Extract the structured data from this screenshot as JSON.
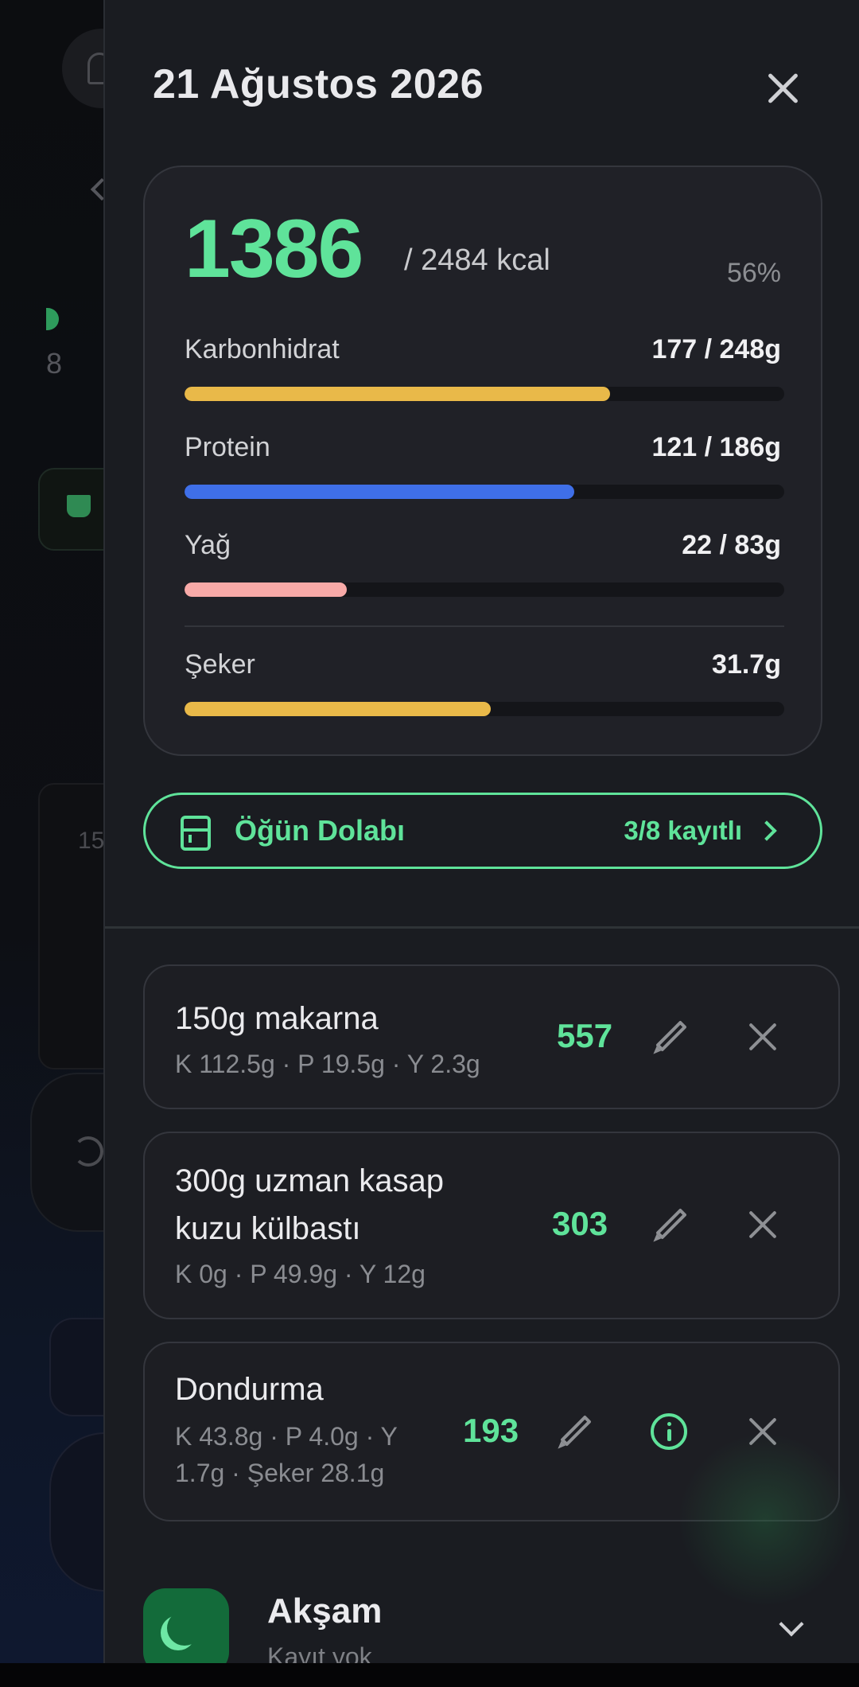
{
  "header": {
    "title": "21 Ağustos 2026"
  },
  "summary": {
    "kcal_consumed": "1386",
    "kcal_goal": "/ 2484 kcal",
    "percent": "56%",
    "macros": [
      {
        "label": "Karbonhidrat",
        "value": "177 / 248g",
        "progress": 0.71,
        "color": "#e9b949"
      },
      {
        "label": "Protein",
        "value": "121 / 186g",
        "progress": 0.65,
        "color": "#3f6fe8"
      },
      {
        "label": "Yağ",
        "value": "22 / 83g",
        "progress": 0.27,
        "color": "#f8aaa8"
      },
      {
        "label": "Şeker",
        "value": "31.7g",
        "progress": 0.51,
        "color": "#e9b949"
      }
    ]
  },
  "pantry": {
    "label": "Öğün Dolabı",
    "count": "3/8 kayıtlı"
  },
  "entries": [
    {
      "name_lines": [
        "150g makarna"
      ],
      "macros_lines": [
        "K 112.5g · P 19.5g · Y 2.3g"
      ],
      "kcal": "557"
    },
    {
      "name_lines": [
        "300g uzman kasap",
        "kuzu külbastı"
      ],
      "macros_lines": [
        "K 0g · P 49.9g · Y 12g"
      ],
      "kcal": "303"
    },
    {
      "name_lines": [
        "Dondurma"
      ],
      "macros_lines": [
        "K 43.8g · P 4.0g · Y",
        "1.7g · Şeker 28.1g"
      ],
      "kcal": "193"
    }
  ],
  "meal": {
    "title": "Akşam",
    "subtitle": "Kayıt yok"
  },
  "icons": {
    "close": "close-icon",
    "pantry": "fridge-icon",
    "edit": "pencil-icon",
    "delete": "x-icon",
    "info": "info-icon",
    "meal": "moon-icon",
    "expand": "chevron-down-icon"
  },
  "colors": {
    "accent": "#5fe39a",
    "sheet_bg": "#1a1c21"
  }
}
